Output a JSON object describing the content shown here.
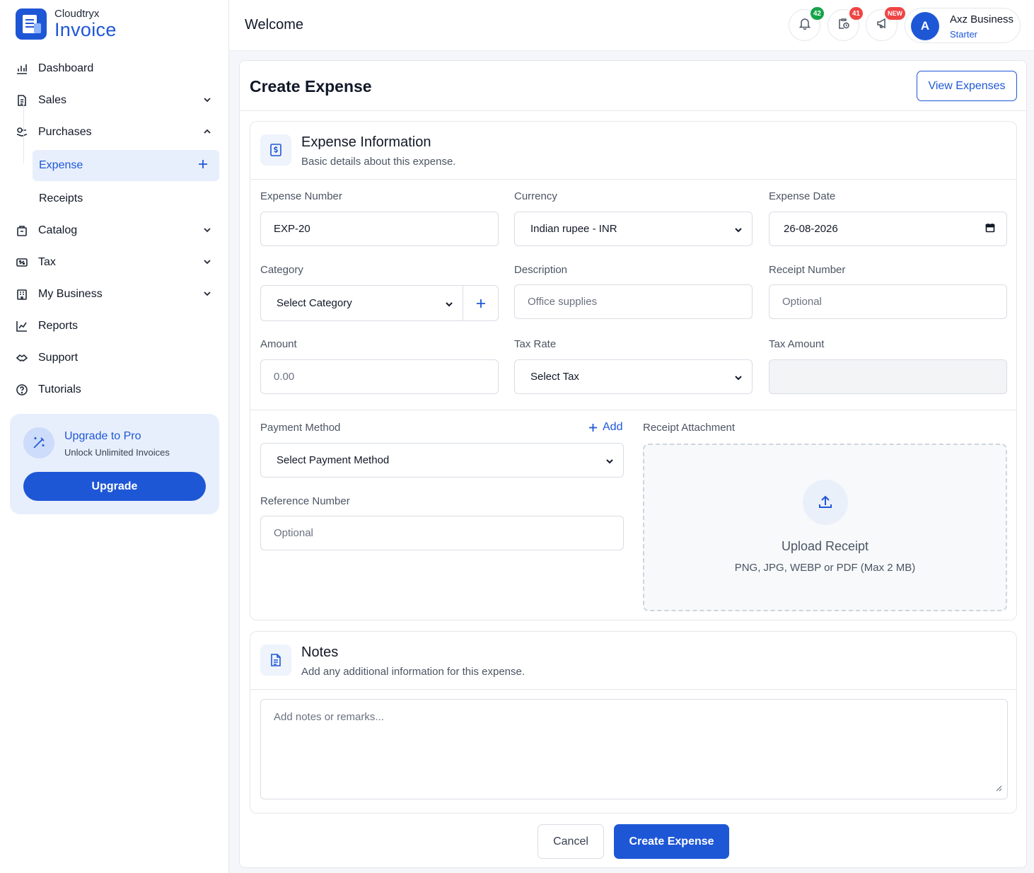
{
  "brand": {
    "top": "Cloudtryx",
    "main": "Invoice"
  },
  "sidebar": {
    "items": [
      {
        "label": "Dashboard",
        "icon": "dashboard-icon"
      },
      {
        "label": "Sales",
        "icon": "document-icon"
      },
      {
        "label": "Purchases",
        "icon": "purchases-icon"
      },
      {
        "label": "Catalog",
        "icon": "catalog-icon"
      },
      {
        "label": "Tax",
        "icon": "tax-icon"
      },
      {
        "label": "My Business",
        "icon": "building-icon"
      },
      {
        "label": "Reports",
        "icon": "chart-icon"
      },
      {
        "label": "Support",
        "icon": "handshake-icon"
      },
      {
        "label": "Tutorials",
        "icon": "help-icon"
      }
    ],
    "sub_items": [
      {
        "label": "Expense",
        "active": true
      },
      {
        "label": "Receipts",
        "active": false
      }
    ],
    "upgrade": {
      "title": "Upgrade to Pro",
      "subtitle": "Unlock Unlimited Invoices",
      "button": "Upgrade"
    }
  },
  "header": {
    "welcome": "Welcome",
    "notifications_count": "42",
    "tasks_count": "41",
    "announcements_badge": "NEW",
    "user": {
      "initial": "A",
      "name": "Axz Business",
      "plan": "Starter"
    }
  },
  "page": {
    "title": "Create Expense",
    "view_button": "View Expenses"
  },
  "expense_info": {
    "title": "Expense Information",
    "subtitle": "Basic details about this expense.",
    "fields": {
      "expense_number": {
        "label": "Expense Number",
        "value": "EXP-20"
      },
      "currency": {
        "label": "Currency",
        "value": "Indian rupee - INR"
      },
      "expense_date": {
        "label": "Expense Date",
        "value": "26-08-2026"
      },
      "category": {
        "label": "Category",
        "value": "Select Category"
      },
      "description": {
        "label": "Description",
        "placeholder": "Office supplies"
      },
      "receipt_number": {
        "label": "Receipt Number",
        "placeholder": "Optional"
      },
      "amount": {
        "label": "Amount",
        "placeholder": "0.00"
      },
      "tax_rate": {
        "label": "Tax Rate",
        "value": "Select Tax"
      },
      "tax_amount": {
        "label": "Tax Amount",
        "value": ""
      },
      "payment_method": {
        "label": "Payment Method",
        "value": "Select Payment Method",
        "add_label": "Add"
      },
      "reference_number": {
        "label": "Reference Number",
        "placeholder": "Optional"
      }
    },
    "attachment": {
      "label": "Receipt Attachment",
      "title": "Upload Receipt",
      "subtitle": "PNG, JPG, WEBP or PDF (Max 2 MB)"
    }
  },
  "notes": {
    "title": "Notes",
    "subtitle": "Add any additional information for this expense.",
    "placeholder": "Add notes or remarks..."
  },
  "actions": {
    "cancel": "Cancel",
    "create": "Create Expense"
  },
  "colors": {
    "primary": "#1e57d6",
    "active_bg": "#e8effc",
    "badge_green": "#16a34a",
    "badge_red": "#ef4444"
  }
}
